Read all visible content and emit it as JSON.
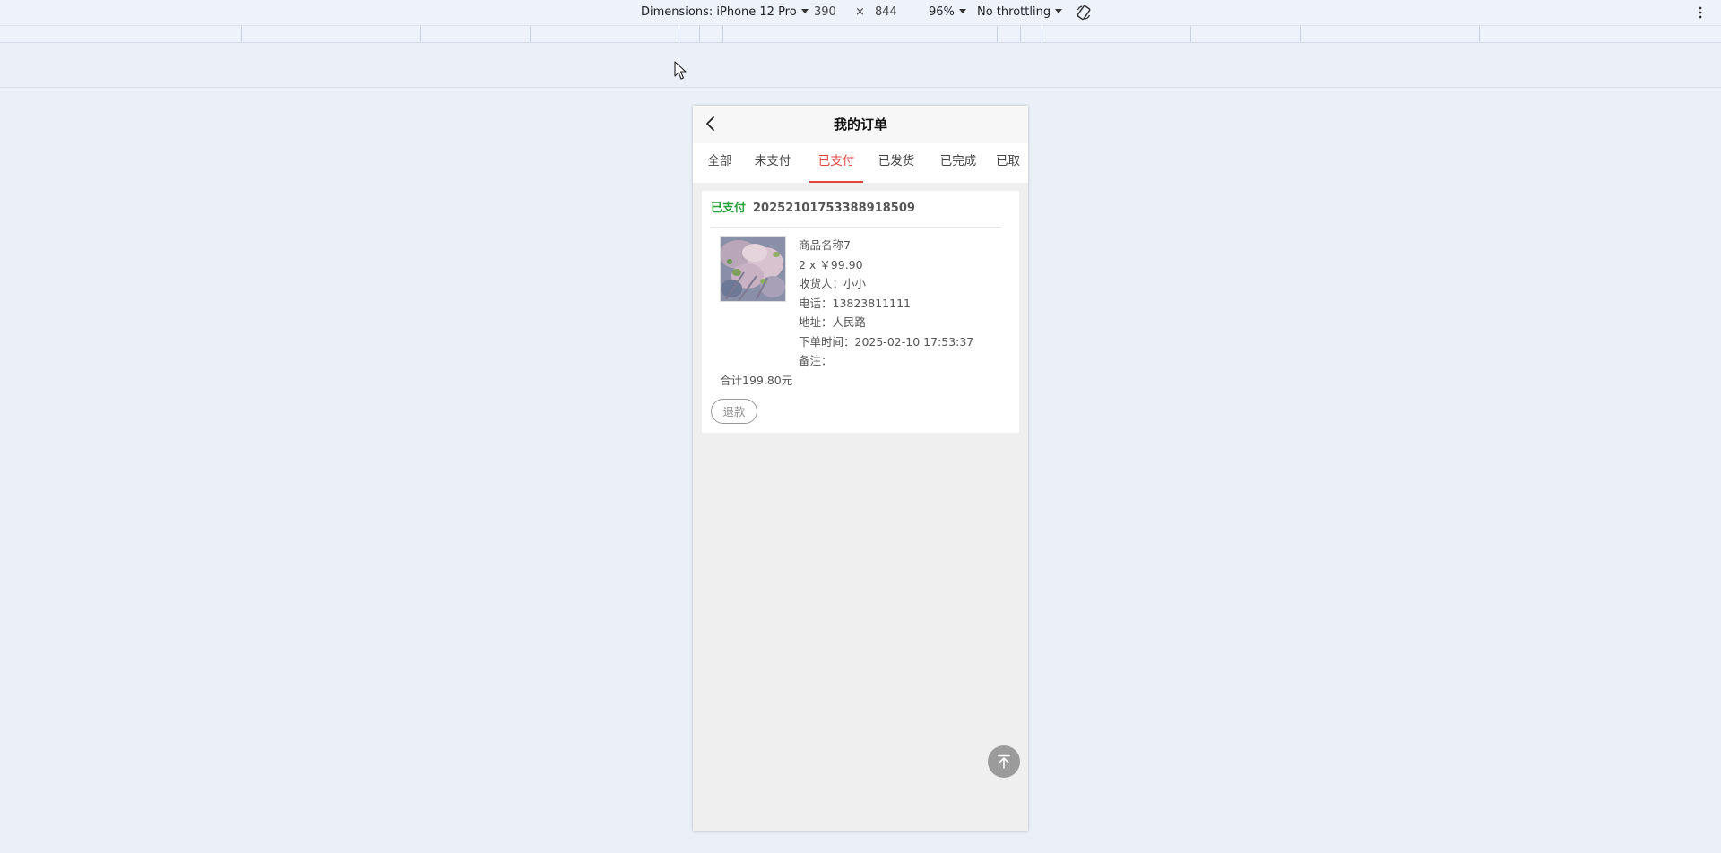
{
  "devtools": {
    "dimensions_label": "Dimensions: iPhone 12 Pro",
    "width": "390",
    "times": "×",
    "height": "844",
    "zoom": "96%",
    "throttling": "No throttling"
  },
  "page": {
    "title": "我的订单",
    "tabs": [
      {
        "label": "全部"
      },
      {
        "label": "未支付"
      },
      {
        "label": "已支付"
      },
      {
        "label": "已发货"
      },
      {
        "label": "已完成"
      },
      {
        "label": "已取"
      }
    ],
    "active_tab": "已支付",
    "accent_color": "#e0443d",
    "status_color": "#29a33c"
  },
  "order": {
    "status": "已支付",
    "order_no": "20252101753388918509",
    "product_name": "商品名称7",
    "qty_price": "2 x ￥99.90",
    "receiver": "收货人：小小",
    "phone": "电话：13823811111",
    "address": "地址：人民路",
    "order_time": "下单时间：2025-02-10 17:53:37",
    "remark": "备注：",
    "total": "合计199.80元",
    "refund_label": "退款"
  },
  "icons": {
    "back": "chevron-left-icon",
    "scroll_top": "arrow-to-top-icon",
    "rotate": "rotate-device-icon",
    "more": "kebab-menu-icon"
  }
}
